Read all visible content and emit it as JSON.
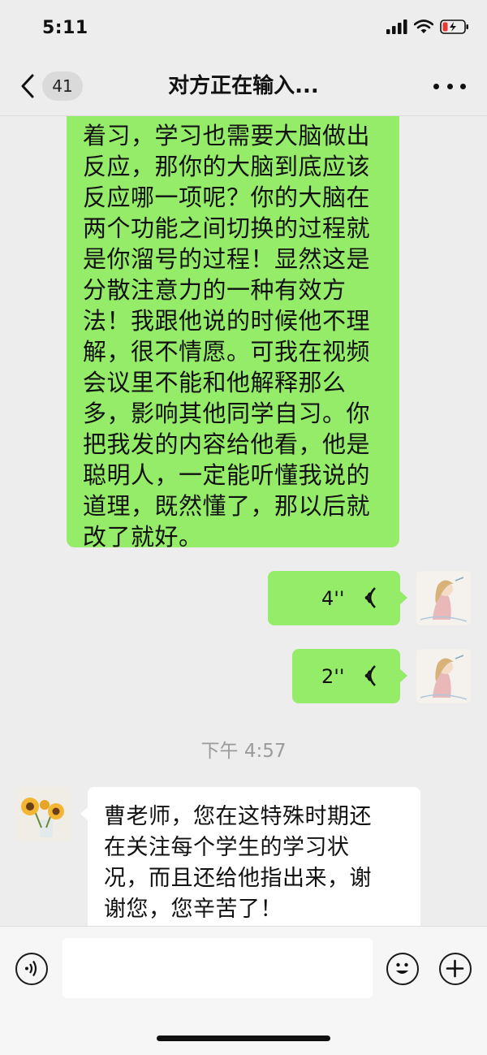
{
  "status_bar": {
    "time": "5:11"
  },
  "nav": {
    "unread_count": "41",
    "title": "对方正在输入..."
  },
  "messages": {
    "long_text_lines": [
      "着习，学习也需要大脑做出",
      "反应，那你的大脑到底应该",
      "反应哪一项呢？你的大脑在",
      "两个功能之间切换的过程就",
      "是你溜号的过程！显然这是",
      "分散注意力的一种有效方",
      "法！我跟他说的时候他不理",
      "解，很不情愿。可我在视频",
      "会议里不能和他解释那么",
      "多，影响其他同学自习。你",
      "把我发的内容给他看，他是",
      "聪明人，一定能听懂我说的",
      "道理，既然懂了，那以后就",
      "改了就好。"
    ],
    "voice_1": {
      "duration": "4''"
    },
    "voice_2": {
      "duration": "2''"
    },
    "timestamp": "下午 4:57",
    "reply_lines": [
      "曹老师，您在这特殊时期还",
      "在关注每个学生的学习状",
      "况，而且还给他指出来，谢",
      "谢您，您辛苦了！"
    ]
  },
  "colors": {
    "sent_bubble": "#95ec69",
    "background": "#ededed",
    "received_bubble": "#ffffff"
  },
  "icons": {
    "back": "chevron-left-icon",
    "more": "more-dots-icon",
    "voice_toggle": "voice-toggle-icon",
    "emoji": "emoji-icon",
    "plus": "plus-icon"
  }
}
